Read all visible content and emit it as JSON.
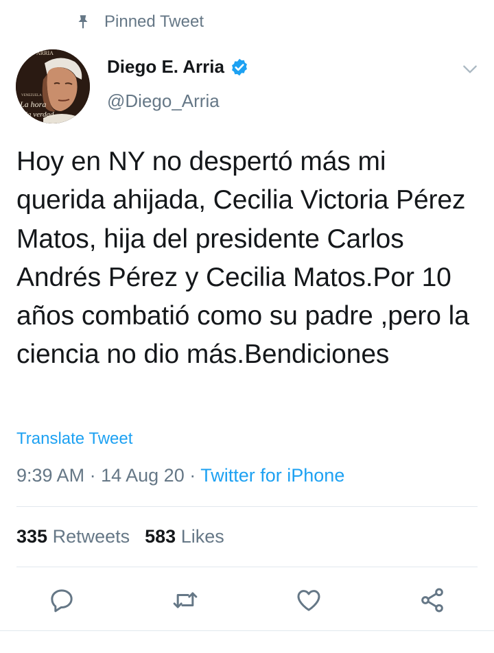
{
  "pinned": {
    "label": "Pinned Tweet",
    "icon": "pin-icon"
  },
  "user": {
    "name": "Diego E. Arria",
    "handle": "@Diego_Arria",
    "verified": true,
    "avatar_lettering": [
      "ARRIA",
      "VENEZUELA",
      "La hora",
      "la verdad"
    ]
  },
  "tweet": {
    "text": "Hoy en NY no despertó más mi querida ahijada, Cecilia Victoria Pérez Matos, hija del presidente Carlos Andrés Pérez y Cecilia Matos.Por 10 años combatió como su padre ,pero la ciencia no dio más.Bendiciones",
    "translate_label": "Translate Tweet",
    "time": "9:39 AM",
    "date": "14 Aug 20",
    "separator": "·",
    "source": "Twitter for iPhone"
  },
  "stats": {
    "retweets_count": "335",
    "retweets_label": "Retweets",
    "likes_count": "583",
    "likes_label": "Likes"
  },
  "actions": [
    "reply-icon",
    "retweet-icon",
    "like-icon",
    "share-icon"
  ],
  "colors": {
    "link": "#1da1f2",
    "secondary_text": "#657786",
    "primary_text": "#14171a",
    "divider": "#e1e8ed",
    "verified": "#1da1f2"
  }
}
